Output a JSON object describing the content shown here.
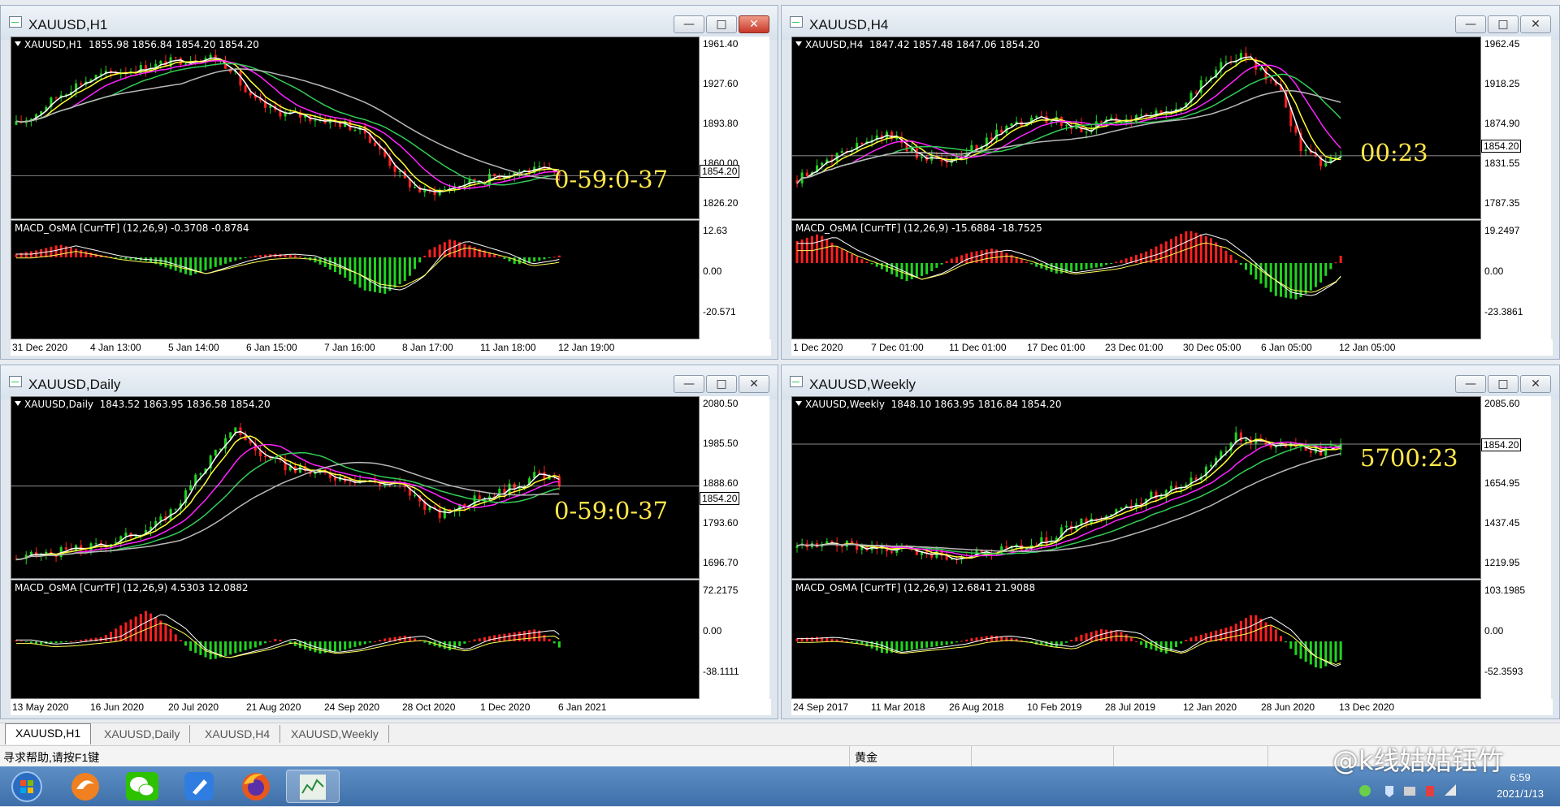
{
  "colors": {
    "bull": "#21d321",
    "bear": "#ff2020",
    "ma_white": "#ffffff",
    "ma_yellow": "#ffff33",
    "ma_magenta": "#ff22ff",
    "ma_green": "#33cc55",
    "ma_gray": "#b8b8b8",
    "timer": "#ffe84a"
  },
  "windows": [
    {
      "title": "XAUUSD,H1",
      "price_label": "XAUUSD,H1  1855.98 1856.84 1854.20 1854.20",
      "y_ticks": [
        "1961.40",
        "1927.60",
        "1893.80",
        "1860.00",
        "1826.20"
      ],
      "current_price": "1854.20",
      "timer": "0-59:0-37",
      "macd_label": "MACD_OsMA [CurrTF] (12,26,9) -0.3708 -0.8784",
      "macd_ticks": [
        "12.63",
        "0.00",
        "-20.571"
      ],
      "x_ticks": [
        "31 Dec 2020",
        "4 Jan 13:00",
        "5 Jan 14:00",
        "6 Jan 15:00",
        "7 Jan 16:00",
        "8 Jan 17:00",
        "11 Jan 18:00",
        "12 Jan 19:00"
      ],
      "active": true
    },
    {
      "title": "XAUUSD,H4",
      "price_label": "XAUUSD,H4  1847.42 1857.48 1847.06 1854.20",
      "y_ticks": [
        "1962.45",
        "1918.25",
        "1874.90",
        "1831.55",
        "1787.35"
      ],
      "current_price": "1854.20",
      "timer": "00:23",
      "macd_label": "MACD_OsMA [CurrTF] (12,26,9) -15.6884 -18.7525",
      "macd_ticks": [
        "19.2497",
        "0.00",
        "-23.3861"
      ],
      "x_ticks": [
        "1 Dec 2020",
        "7 Dec 01:00",
        "11 Dec 01:00",
        "17 Dec 01:00",
        "23 Dec 01:00",
        "30 Dec 05:00",
        "6 Jan 05:00",
        "12 Jan 05:00"
      ],
      "active": false
    },
    {
      "title": "XAUUSD,Daily",
      "price_label": "XAUUSD,Daily  1843.52 1863.95 1836.58 1854.20",
      "y_ticks": [
        "2080.50",
        "1985.50",
        "1888.60",
        "1793.60",
        "1696.70"
      ],
      "current_price": "1854.20",
      "timer": "0-59:0-37",
      "macd_label": "MACD_OsMA [CurrTF] (12,26,9) 4.5303 12.0882",
      "macd_ticks": [
        "72.2175",
        "0.00",
        "-38.1111"
      ],
      "x_ticks": [
        "13 May 2020",
        "16 Jun 2020",
        "20 Jul 2020",
        "21 Aug 2020",
        "24 Sep 2020",
        "28 Oct 2020",
        "1 Dec 2020",
        "6 Jan 2021"
      ],
      "active": false
    },
    {
      "title": "XAUUSD,Weekly",
      "price_label": "XAUUSD,Weekly  1848.10 1863.95 1816.84 1854.20",
      "y_ticks": [
        "2085.60",
        "1854.20",
        "1654.95",
        "1437.45",
        "1219.95"
      ],
      "current_price": "1854.20",
      "timer": "5700:23",
      "macd_label": "MACD_OsMA [CurrTF] (12,26,9) 12.6841 21.9088",
      "macd_ticks": [
        "103.1985",
        "0.00",
        "-52.3593"
      ],
      "x_ticks": [
        "24 Sep 2017",
        "11 Mar 2018",
        "26 Aug 2018",
        "10 Feb 2019",
        "28 Jul 2019",
        "12 Jan 2020",
        "28 Jun 2020",
        "13 Dec 2020"
      ],
      "active": false
    }
  ],
  "tabs": [
    "XAUUSD,H1",
    "XAUUSD,Daily",
    "XAUUSD,H4",
    "XAUUSD,Weekly"
  ],
  "status": {
    "help": "寻求帮助,请按F1键",
    "profile": "黄金"
  },
  "taskbar": {
    "apps": [
      "start-orb-icon",
      "browser-icon",
      "wechat-icon",
      "note-icon",
      "firefox-icon",
      "metatrader-icon"
    ],
    "time": "6:59",
    "date": "2021/1/13"
  },
  "watermark": "@k线姑姑钰竹"
}
